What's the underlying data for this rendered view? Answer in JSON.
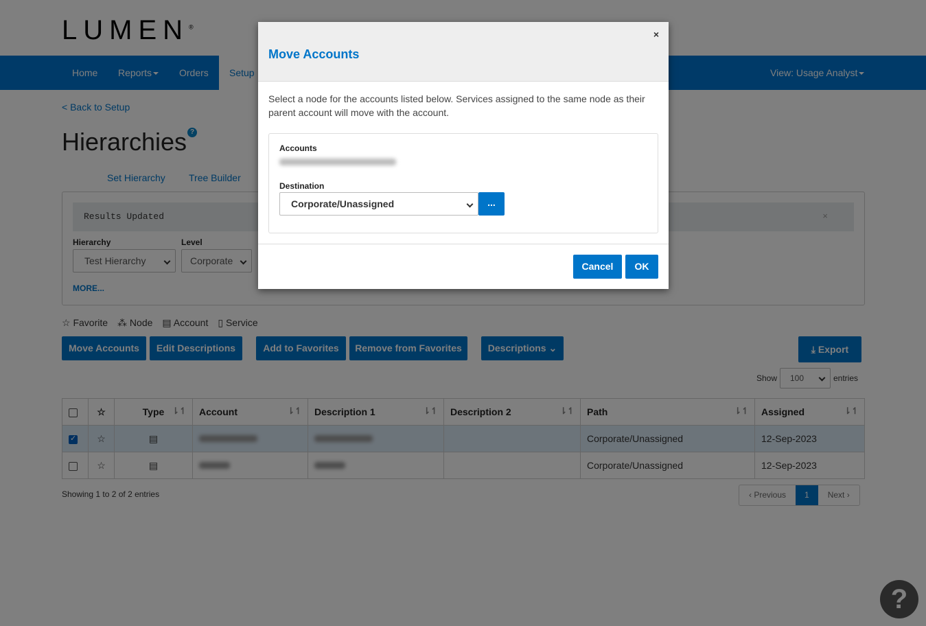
{
  "brand": {
    "logo": "LUMEN"
  },
  "nav": {
    "items": [
      {
        "label": "Home"
      },
      {
        "label": "Reports"
      },
      {
        "label": "Orders"
      },
      {
        "label": "Setup"
      }
    ],
    "view": "View: Usage Analyst"
  },
  "page": {
    "back": "< Back to Setup",
    "title": "Hierarchies",
    "tabs": [
      "Set Hierarchy",
      "Tree Builder"
    ]
  },
  "filters": {
    "alert": "Results Updated",
    "hierarchy_label": "Hierarchy",
    "hierarchy_value": "Test Hierarchy",
    "level_label": "Level",
    "level_value": "Corporate",
    "more": "MORE..."
  },
  "legend": {
    "favorite": "Favorite",
    "node": "Node",
    "account": "Account",
    "service": "Service"
  },
  "toolbar": {
    "move": "Move Accounts",
    "edit": "Edit Descriptions",
    "add_fav": "Add to Favorites",
    "remove_fav": "Remove from Favorites",
    "descriptions": "Descriptions",
    "export": "Export"
  },
  "length": {
    "show": "Show",
    "value": "100",
    "entries": "entries"
  },
  "table": {
    "headers": [
      "Type",
      "Account",
      "Description 1",
      "Description 2",
      "Path",
      "Assigned"
    ],
    "rows": [
      {
        "checked": true,
        "path": "Corporate/Unassigned",
        "assigned": "12-Sep-2023"
      },
      {
        "checked": false,
        "path": "Corporate/Unassigned",
        "assigned": "12-Sep-2023"
      }
    ]
  },
  "info": "Showing 1 to 2 of 2 entries",
  "pager": {
    "prev": "Previous",
    "page": "1",
    "next": "Next"
  },
  "modal": {
    "title": "Move Accounts",
    "close": "×",
    "text": "Select a node for the accounts listed below. Services assigned to the same node as their parent account will move with the account.",
    "accounts_label": "Accounts",
    "destination_label": "Destination",
    "destination_value": "Corporate/Unassigned",
    "browse": "...",
    "cancel": "Cancel",
    "ok": "OK"
  },
  "help_fab": "?",
  "colors": {
    "primary": "#0075c9",
    "overlay": "rgba(0,0,0,0.5)"
  }
}
